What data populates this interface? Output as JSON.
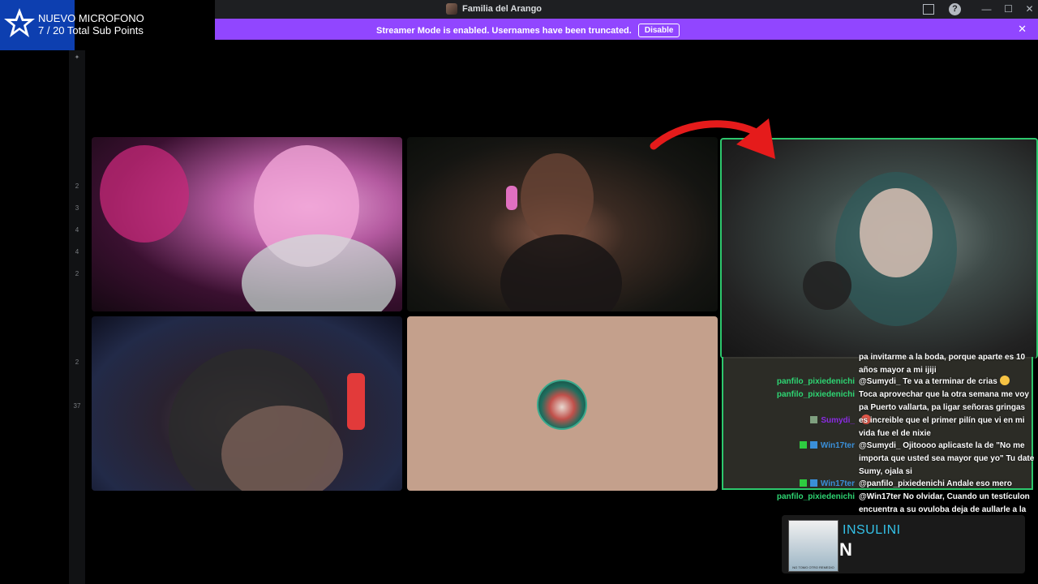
{
  "window": {
    "title": "Familia del Arango",
    "controls": {
      "minimize": "—",
      "maximize": "☐",
      "close": "✕"
    },
    "help_label": "?"
  },
  "banner": {
    "text": "Streamer Mode is enabled. Usernames have been truncated.",
    "button": "Disable",
    "close": "✕",
    "color": "#9146ff"
  },
  "subgoal": {
    "title": "NUEVO MICROFONO",
    "progress": "7 / 20 Total Sub Points",
    "current": 7,
    "goal": 20
  },
  "rail": {
    "marks": [
      "✦",
      "2",
      "3",
      "4",
      "4",
      "2",
      "2",
      "37"
    ]
  },
  "video_tiles": [
    {
      "name": "participant-1"
    },
    {
      "name": "participant-2"
    },
    {
      "name": "participant-3"
    },
    {
      "name": "participant-4-avatar"
    },
    {
      "name": "participant-5-speaking",
      "speaking_color": "#2dc76d"
    }
  ],
  "chat": {
    "messages": [
      {
        "user": "",
        "color": "#ffffff",
        "text": "pa invitarme a la boda, porque aparte es 10 años mayor a mi ijiji"
      },
      {
        "user": "panfilo_pixiedenichi",
        "color": "#2ed573",
        "text": "@Sumydi_ Te va a terminar de crias"
      },
      {
        "user": "panfilo_pixiedenichi",
        "color": "#2ed573",
        "text": "Toca aprovechar que la otra semana me voy pa Puerto vallarta, pa ligar señoras gringas"
      },
      {
        "user": "Sumydi_",
        "color": "#8a2be2",
        "text": "es increible que el primer pilín que vi en mi vida fue el de nixie"
      },
      {
        "user": "Win17ter",
        "color": "#3a8fd8",
        "text": "@Sumydi_ Ojitoooo aplicaste la de \"No me importa que usted sea mayor que yo\" Tu date Sumy, ojala si"
      },
      {
        "user": "Win17ter",
        "color": "#3a8fd8",
        "text": "@panfilo_pixiedenichi Andale eso mero"
      },
      {
        "user": "panfilo_pixiedenichi",
        "color": "#2ed573",
        "text": "@Win17ter No olvidar, Cuando un testículon encuentra a su ovuloba deja de aullarle a la"
      }
    ]
  },
  "ad": {
    "title": "INSULINI",
    "subtitle": "N",
    "thumb_caption": "NO TOMO OTRO REMEDIO"
  }
}
